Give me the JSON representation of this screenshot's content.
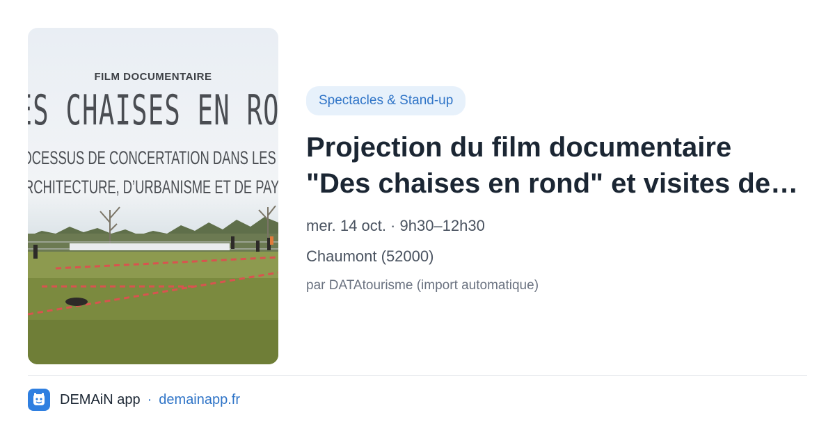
{
  "poster": {
    "kicker": "FILM DOCUMENTAIRE",
    "title": "DES CHAISES EN ROND",
    "subtitle_line1": "PROCESSUS DE CONCERTATION DANS LES PROJETS",
    "subtitle_line2": "D'ARCHITECTURE, D’URBANISME ET DE PAYSAGE"
  },
  "event": {
    "category": "Spectacles & Stand-up",
    "title_line1": "Projection du film documentaire",
    "title_line2": "\"Des chaises en rond\" et visites de…",
    "date": "mer. 14 oct. · 9h30–12h30",
    "location": "Chaumont (52000)",
    "source": "par DATAtourisme (import automatique)"
  },
  "footer": {
    "app_name": "DEMAiN app",
    "separator": "·",
    "link": "demainapp.fr",
    "icon": "demain-app-icon"
  },
  "colors": {
    "accent": "#2f74c7",
    "category_bg": "#e7f1fb",
    "app_icon_bg": "#2f7fe0"
  }
}
